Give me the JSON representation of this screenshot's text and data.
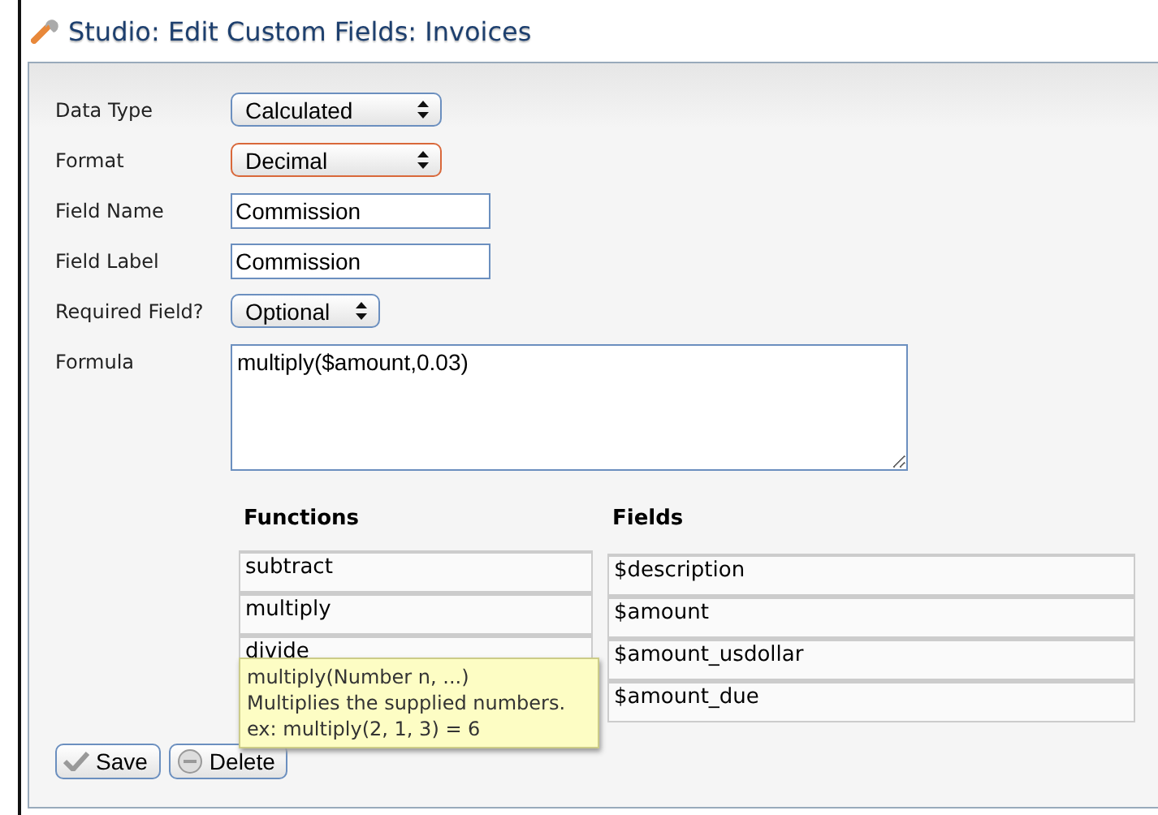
{
  "window": {
    "title": "Studio: Edit Custom Fields: Invoices"
  },
  "form": [
    {
      "kind": "select",
      "label": "Data Type",
      "value": "Calculated",
      "focused": false
    },
    {
      "kind": "select",
      "label": "Format",
      "value": "Decimal",
      "focused": true
    },
    {
      "kind": "text",
      "label": "Field Name",
      "value": "Commission"
    },
    {
      "kind": "text",
      "label": "Field Label",
      "value": "Commission"
    },
    {
      "kind": "select",
      "label": "Required Field?",
      "value": "Optional",
      "focused": false
    },
    {
      "kind": "textarea",
      "label": "Formula",
      "value": "multiply($amount,0.03)"
    }
  ],
  "functions": {
    "heading": "Functions",
    "items": [
      "subtract",
      "multiply",
      "divide"
    ]
  },
  "fields": {
    "heading": "Fields",
    "items": [
      "$description",
      "$amount",
      "$amount_usdollar",
      "$amount_due"
    ]
  },
  "tooltip": {
    "lines": [
      "multiply(Number n, ...)",
      "Multiplies the supplied numbers.",
      "ex: multiply(2, 1, 3) = 6"
    ]
  },
  "buttons": [
    {
      "kind": "save",
      "label": "Save"
    },
    {
      "kind": "delete",
      "label": "Delete"
    }
  ]
}
